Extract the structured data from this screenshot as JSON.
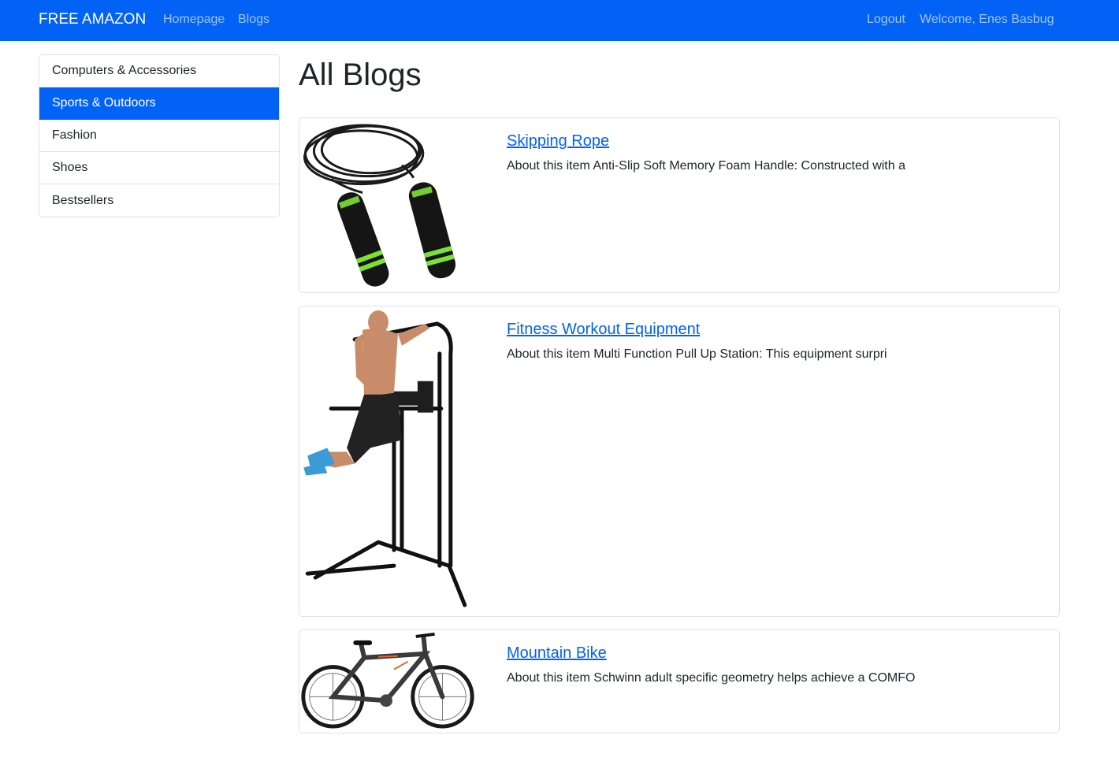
{
  "navbar": {
    "brand": "FREE AMAZON",
    "links": [
      "Homepage",
      "Blogs"
    ],
    "right_links": [
      "Logout",
      "Welcome, Enes Basbug"
    ],
    "color": "#0262f5"
  },
  "sidebar": {
    "items": [
      {
        "label": "Computers & Accessories",
        "active": false
      },
      {
        "label": "Sports & Outdoors",
        "active": true
      },
      {
        "label": "Fashion",
        "active": false
      },
      {
        "label": "Shoes",
        "active": false
      },
      {
        "label": "Bestsellers",
        "active": false
      }
    ]
  },
  "main": {
    "title": "All Blogs",
    "blogs": [
      {
        "title": "Skipping Rope",
        "excerpt": "About this item Anti-Slip Soft Memory Foam Handle: Constructed with a",
        "icon": "skipping-rope-image"
      },
      {
        "title": "Fitness Workout Equipment",
        "excerpt": "About this item Multi Function Pull Up Station: This equipment surpri",
        "icon": "pull-up-station-image"
      },
      {
        "title": "Mountain Bike",
        "excerpt": "About this item Schwinn adult specific geometry helps achieve a COMFO",
        "icon": "mountain-bike-image"
      }
    ]
  }
}
